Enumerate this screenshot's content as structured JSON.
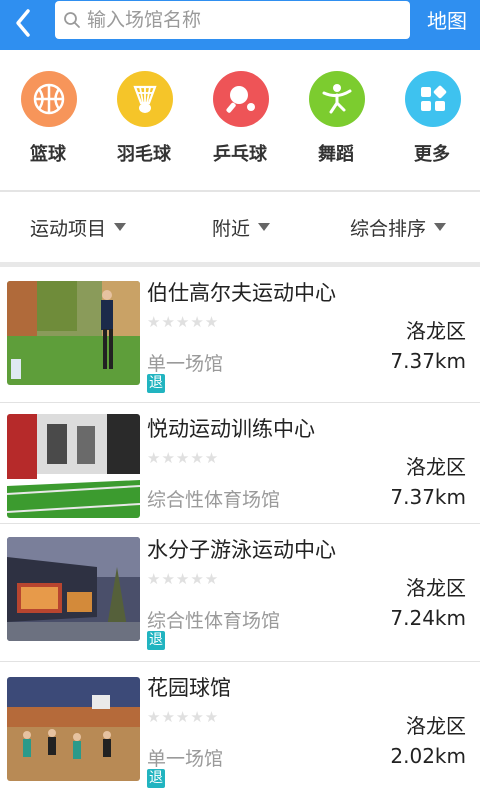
{
  "header": {
    "search_placeholder": "输入场馆名称",
    "map_label": "地图",
    "bar_color": "#2f8ff0"
  },
  "categories": [
    {
      "label": "篮球",
      "icon": "basketball-icon",
      "color": "#f7955a"
    },
    {
      "label": "羽毛球",
      "icon": "shuttlecock-icon",
      "color": "#f5c529"
    },
    {
      "label": "乒乓球",
      "icon": "ping-pong-icon",
      "color": "#ee5457"
    },
    {
      "label": "舞蹈",
      "icon": "dance-icon",
      "color": "#7ccc2f"
    },
    {
      "label": "更多",
      "icon": "grid-icon",
      "color": "#3ec2ef"
    }
  ],
  "filters": [
    {
      "label": "运动项目"
    },
    {
      "label": "附近"
    },
    {
      "label": "综合排序"
    }
  ],
  "venues": [
    {
      "name": "伯仕高尔夫运动中心",
      "stars": "★★★★★",
      "district": "洛龙区",
      "type": "单一场馆",
      "distance": "7.37km",
      "badge": "退"
    },
    {
      "name": "悦动运动训练中心",
      "stars": "★★★★★",
      "district": "洛龙区",
      "type": "综合性体育场馆",
      "distance": "7.37km",
      "badge": ""
    },
    {
      "name": "水分子游泳运动中心",
      "stars": "★★★★★",
      "district": "洛龙区",
      "type": "综合性体育场馆",
      "distance": "7.24km",
      "badge": "退"
    },
    {
      "name": "花园球馆",
      "stars": "★★★★★",
      "district": "洛龙区",
      "type": "单一场馆",
      "distance": "2.02km",
      "badge": "退"
    }
  ],
  "accent_badge_color": "#21b4c0"
}
